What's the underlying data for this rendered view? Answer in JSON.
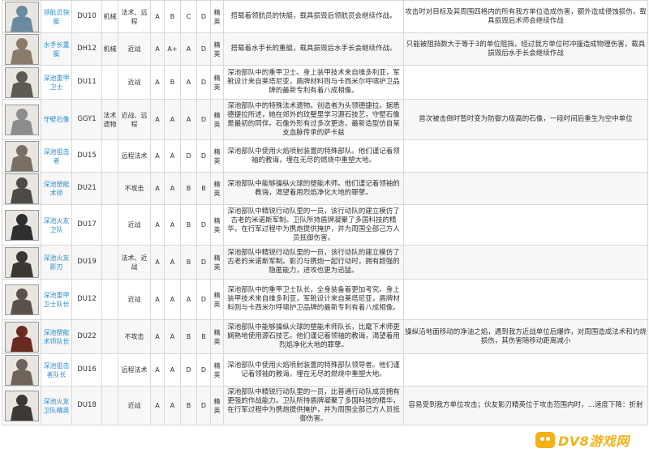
{
  "rows": [
    {
      "name": "领航员快艇",
      "code": "DU10",
      "cat": "机械",
      "attack": "法术、远程",
      "hp": "A",
      "atk": "B",
      "def": "C",
      "res": "D",
      "tag": "精英",
      "desc": "搭载着领航员的快艇，载具损毁后领航员会继续作战。",
      "skill": "攻击时对目标及其周围四格内的所有我方单位造成伤害，额外造成侵蚀损伤，载具损毁后术师会继续作战",
      "portrait_color": "#6b8aa0"
    },
    {
      "name": "水手长重艇",
      "code": "DH12",
      "cat": "机械",
      "attack": "近战",
      "hp": "A",
      "atk": "A+",
      "def": "A",
      "res": "D",
      "tag": "精英",
      "desc": "搭载着水手长的重艇，载具损毁后水手长会继续作战。",
      "skill": "只能被阻挡数大于等于3的单位阻挡，经过我方单位时冲撞造成物理伤害，载具损毁后水手长会继续作战",
      "portrait_color": "#8a7c6a"
    },
    {
      "name": "深池重甲卫士",
      "code": "DU11",
      "cat": "",
      "attack": "近战",
      "hp": "A",
      "atk": "B",
      "def": "A",
      "res": "D",
      "tag": "精英",
      "desc": "深池部队中的重甲卫士。身上装甲技术来自维多利亚，军靴设计来自莱塔尼亚，盾牌材料则与卡西米尔呼啸护卫品牌的最新专利有着八成相像。",
      "skill": "",
      "portrait_color": "#5e5a52"
    },
    {
      "name": "守壁石像",
      "code": "GGY1",
      "cat": "法术遗物",
      "attack": "近战、远程",
      "hp": "A",
      "atk": "A",
      "def": "A",
      "res": "D",
      "tag": "精英",
      "desc": "深池部队中的特殊法术遗物。创造者为头领德捷拉。据悉德捷拉所述，她在郊外的玟璧里学习源石技艺，守壁石像是最初的同伴。石像外形有过多次更迭，最新造型仿自某支血脉传承的萨卡兹",
      "skill": "首次被击倒时暂时变为防御力极高的石像，一段时间后重生为空中单位",
      "portrait_color": "#8c8c8c"
    },
    {
      "name": "深池狙击者",
      "code": "DU15",
      "cat": "",
      "attack": "远程法术",
      "hp": "A",
      "atk": "A",
      "def": "D",
      "res": "D",
      "tag": "精英",
      "desc": "深池部队中使用火焰喷射装置的特殊部队。他们谨记着领袖的教诲，埋在无尽的燃烧中重塑大地。",
      "skill": "",
      "portrait_color": "#7a6f64"
    },
    {
      "name": "深池塑能术师",
      "code": "DU21",
      "cat": "",
      "attack": "不攻击",
      "hp": "A",
      "atk": "A",
      "def": "B",
      "res": "B",
      "tag": "精英",
      "desc": "深池部队中能够操纵火球的塑能术师。他们谨记着领袖的教诲，渴望着用烈焰净化大地的罪孽。",
      "skill": "",
      "portrait_color": "#4e4a46"
    },
    {
      "name": "深池火友卫队",
      "code": "DU17",
      "cat": "",
      "attack": "近战",
      "hp": "A",
      "atk": "A",
      "def": "B",
      "res": "D",
      "tag": "精英",
      "desc": "深池部队中精锐行动队里的一员，该行动队的建立模仿了古老的米诺斯军制。卫队所持盾牌凝聚了多国科技的精华，在行军过程中为携炮提供掩护，并为周围全部己方人员抵御伤害。",
      "skill": "",
      "portrait_color": "#2f2f2f"
    },
    {
      "name": "深池火友影刃",
      "code": "DU19",
      "cat": "",
      "attack": "法术、近战",
      "hp": "A",
      "atk": "A",
      "def": "B",
      "res": "D",
      "tag": "精英",
      "desc": "深池部队中精锐行动队里的一员，该行动队的建立模仿了古老的米诺斯军制。影刃与携炮一起行动时，拥有超强的隐匿能力，进攻也更为迅猛。",
      "skill": "",
      "portrait_color": "#3a3632"
    },
    {
      "name": "深池重甲卫士队长",
      "code": "DU12",
      "cat": "",
      "attack": "近战",
      "hp": "A",
      "atk": "A",
      "def": "A",
      "res": "D",
      "tag": "精英",
      "desc": "深池部队中的重甲卫士队长，全身装备着更加考究。身上装甲技术来自维多利亚，军靴设计来自莱塔尼亚，盾牌材料则与卡西米尔呼啸护卫品牌的最新专利有着八成相像。",
      "skill": "",
      "portrait_color": "#5a524a"
    },
    {
      "name": "深池塑能术师队长",
      "code": "DU22",
      "cat": "",
      "attack": "不攻击",
      "hp": "A",
      "atk": "A",
      "def": "B",
      "res": "B",
      "tag": "精英",
      "desc": "深池部队中能够操纵火球的塑能术师队长，比麾下术师更娴熟地使用源石技艺。他们谨记着领袖的教诲，渴望着用烈焰净化大地的罪孽。",
      "skill": "操纵沿地面移动的净油之焰，遇到我方近战单位后爆炸，对周围造成法术和灼烧损伤，其伤害随移动距离减小",
      "portrait_color": "#6a2a22"
    },
    {
      "name": "深池狙击者队长",
      "code": "DU16",
      "cat": "",
      "attack": "远程法术",
      "hp": "A",
      "atk": "A",
      "def": "D",
      "res": "D",
      "tag": "精英",
      "desc": "深池部队中使用火焰喷射装置的特殊部队领导者。他们谨记着领袖的教诲，埋在无尽的燃烧中重塑大地。",
      "skill": "",
      "portrait_color": "#6e645a"
    },
    {
      "name": "深池火友卫队精英",
      "code": "DU18",
      "cat": "",
      "attack": "近战",
      "hp": "A",
      "atk": "A",
      "def": "B",
      "res": "D",
      "tag": "精英",
      "desc": "深池部队中精锐行动队里的一员，比普通行动队成员拥有更强的作战能力。卫队所持盾牌凝聚了多国科技的精华，在行军过程中为携炮提供掩护，并为周围全部己方人员抵御伤害。",
      "skill": "容易受到我方单位攻击；伙友影刃精英位于攻击范围内时，…速度下降：折射",
      "portrait_color": "#3c3833"
    }
  ],
  "watermark": {
    "text": "DV8游戏网",
    "color": "#f2a900"
  }
}
